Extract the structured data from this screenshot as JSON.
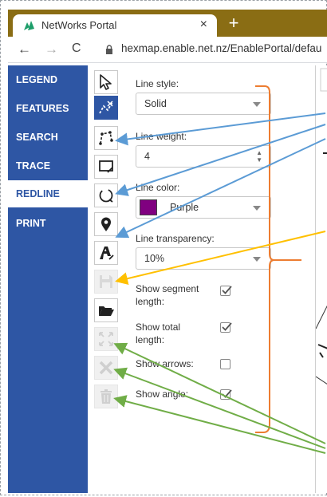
{
  "browser": {
    "tab_title": "NetWorks Portal",
    "tab_close": "×",
    "new_tab": "+",
    "url": "hexmap.enable.net.nz/EnablePortal/defau",
    "back": "←",
    "forward": "→",
    "reload": "C"
  },
  "sidebar": {
    "items": [
      {
        "label": "LEGEND"
      },
      {
        "label": "FEATURES"
      },
      {
        "label": "SEARCH"
      },
      {
        "label": "TRACE"
      },
      {
        "label": "REDLINE",
        "active": true
      },
      {
        "label": "PRINT"
      }
    ],
    "color": "#2e56a4"
  },
  "toolbar": {
    "tools": [
      {
        "icon": "select-arrow-icon"
      },
      {
        "icon": "line-draw-icon",
        "active": true
      },
      {
        "icon": "polygon-draw-icon"
      },
      {
        "icon": "rectangle-draw-icon"
      },
      {
        "icon": "circle-draw-icon"
      },
      {
        "icon": "point-marker-icon"
      },
      {
        "icon": "text-draw-icon"
      },
      {
        "icon": "save-icon",
        "disabled": true
      },
      {
        "icon": "open-folder-icon"
      },
      {
        "icon": "zoom-extent-icon",
        "disabled": true
      },
      {
        "icon": "delete-x-icon",
        "disabled": true
      },
      {
        "icon": "trash-icon",
        "disabled": true
      }
    ]
  },
  "panel": {
    "line_style_label": "Line style:",
    "line_style_value": "Solid",
    "line_weight_label": "Line weight:",
    "line_weight_value": "4",
    "line_color_label": "Line color:",
    "line_color_value": "Purple",
    "line_color_hex": "#800080",
    "line_transparency_label": "Line transparency:",
    "line_transparency_value": "10%",
    "show_segment_length_label": "Show segment length:",
    "show_segment_length_checked": true,
    "show_total_length_label": "Show total length:",
    "show_total_length_checked": true,
    "show_arrows_label": "Show arrows:",
    "show_arrows_checked": false,
    "show_angle_label": "Show angle:",
    "show_angle_checked": true
  },
  "annotation_colors": {
    "blue": "#5b9bd5",
    "orange": "#ed7d31",
    "yellow": "#ffc000",
    "green": "#70ad47"
  }
}
